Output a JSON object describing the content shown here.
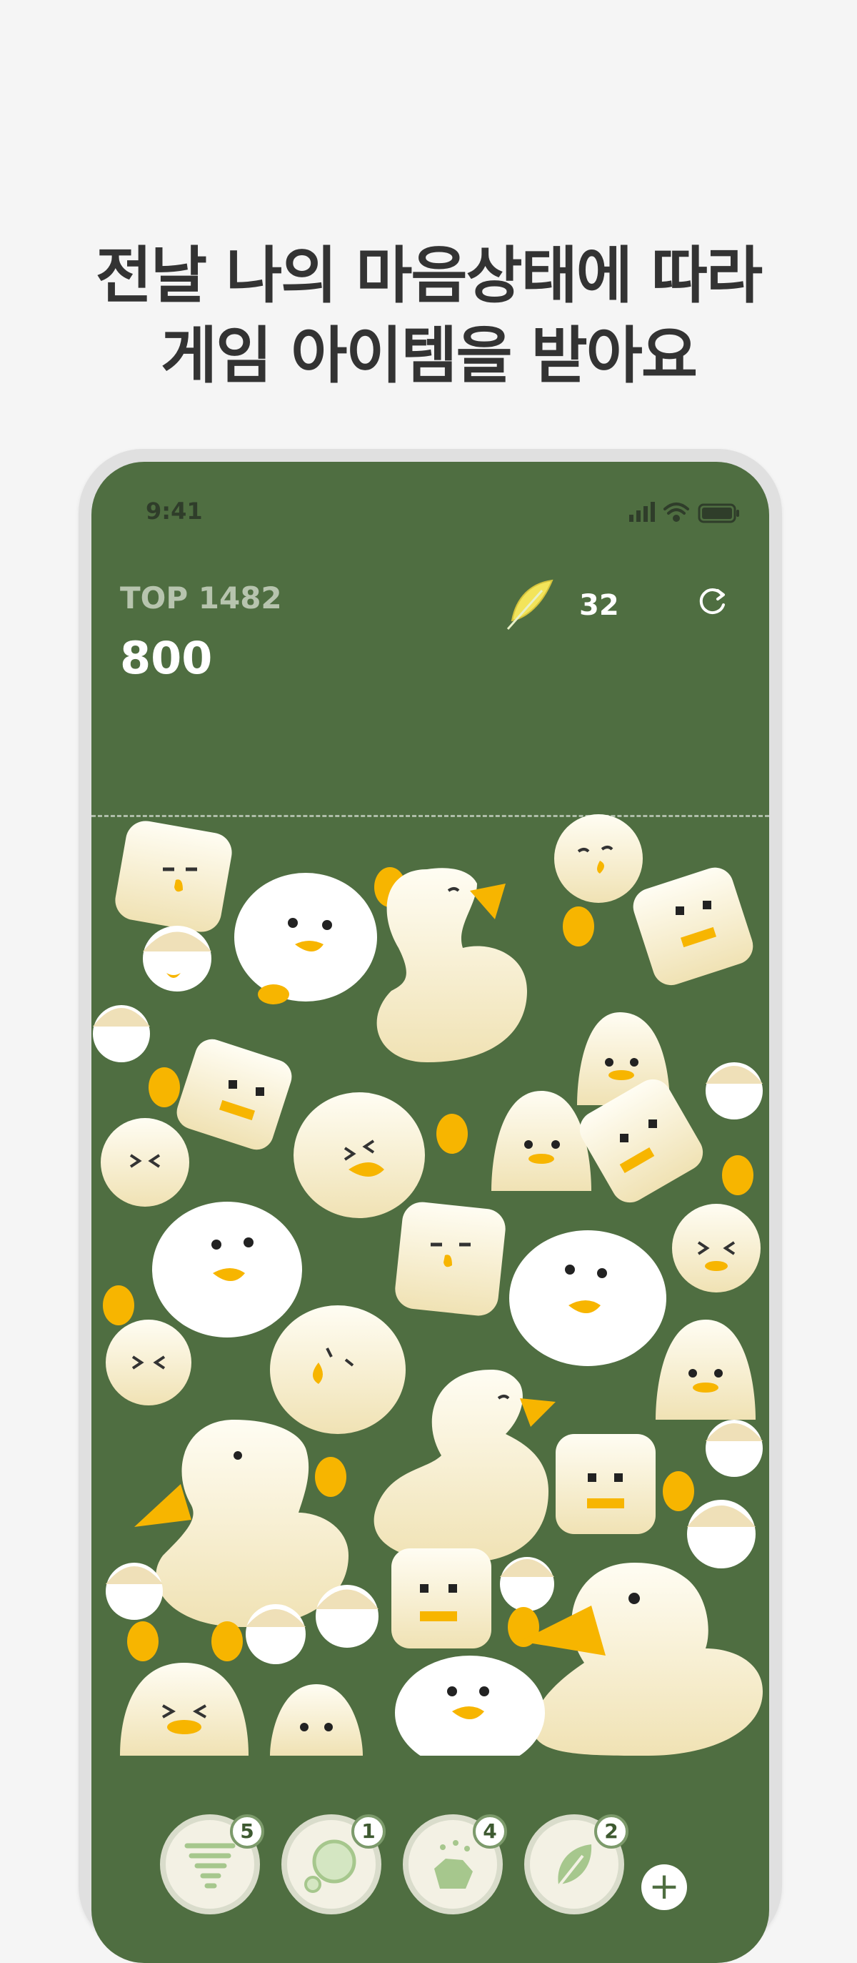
{
  "headline": {
    "line1": "전날 나의 마음상태에 따라",
    "line2": "게임 아이템을 받아요"
  },
  "status_bar": {
    "time": "9:41",
    "icons": [
      "signal-icon",
      "wifi-icon",
      "battery-icon"
    ]
  },
  "game": {
    "top_rank": "TOP 1482",
    "score": "800",
    "feather_count": "32",
    "feather_icon": "feather-icon",
    "refresh_icon": "refresh-icon"
  },
  "items": [
    {
      "name": "tornado",
      "icon": "tornado-icon",
      "count": "5"
    },
    {
      "name": "bubble",
      "icon": "bubble-icon",
      "count": "1"
    },
    {
      "name": "stone",
      "icon": "stone-icon",
      "count": "4"
    },
    {
      "name": "leaf",
      "icon": "leaf-icon",
      "count": "2"
    }
  ],
  "add_button": "+",
  "colors": {
    "background": "#f5f5f5",
    "screen": "#4f6e41",
    "cream": "#f7efd2",
    "beak": "#f7b500",
    "white": "#ffffff"
  }
}
